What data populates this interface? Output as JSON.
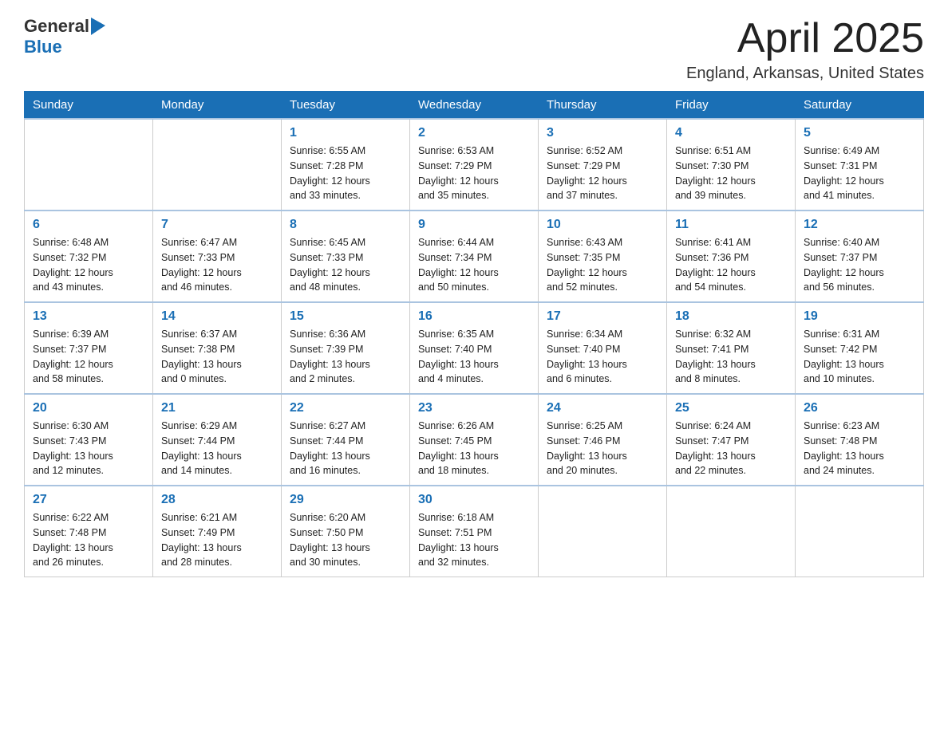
{
  "header": {
    "logo_general": "General",
    "logo_blue": "Blue",
    "title": "April 2025",
    "location": "England, Arkansas, United States"
  },
  "days_of_week": [
    "Sunday",
    "Monday",
    "Tuesday",
    "Wednesday",
    "Thursday",
    "Friday",
    "Saturday"
  ],
  "weeks": [
    [
      {
        "day": "",
        "info": ""
      },
      {
        "day": "",
        "info": ""
      },
      {
        "day": "1",
        "info": "Sunrise: 6:55 AM\nSunset: 7:28 PM\nDaylight: 12 hours\nand 33 minutes."
      },
      {
        "day": "2",
        "info": "Sunrise: 6:53 AM\nSunset: 7:29 PM\nDaylight: 12 hours\nand 35 minutes."
      },
      {
        "day": "3",
        "info": "Sunrise: 6:52 AM\nSunset: 7:29 PM\nDaylight: 12 hours\nand 37 minutes."
      },
      {
        "day": "4",
        "info": "Sunrise: 6:51 AM\nSunset: 7:30 PM\nDaylight: 12 hours\nand 39 minutes."
      },
      {
        "day": "5",
        "info": "Sunrise: 6:49 AM\nSunset: 7:31 PM\nDaylight: 12 hours\nand 41 minutes."
      }
    ],
    [
      {
        "day": "6",
        "info": "Sunrise: 6:48 AM\nSunset: 7:32 PM\nDaylight: 12 hours\nand 43 minutes."
      },
      {
        "day": "7",
        "info": "Sunrise: 6:47 AM\nSunset: 7:33 PM\nDaylight: 12 hours\nand 46 minutes."
      },
      {
        "day": "8",
        "info": "Sunrise: 6:45 AM\nSunset: 7:33 PM\nDaylight: 12 hours\nand 48 minutes."
      },
      {
        "day": "9",
        "info": "Sunrise: 6:44 AM\nSunset: 7:34 PM\nDaylight: 12 hours\nand 50 minutes."
      },
      {
        "day": "10",
        "info": "Sunrise: 6:43 AM\nSunset: 7:35 PM\nDaylight: 12 hours\nand 52 minutes."
      },
      {
        "day": "11",
        "info": "Sunrise: 6:41 AM\nSunset: 7:36 PM\nDaylight: 12 hours\nand 54 minutes."
      },
      {
        "day": "12",
        "info": "Sunrise: 6:40 AM\nSunset: 7:37 PM\nDaylight: 12 hours\nand 56 minutes."
      }
    ],
    [
      {
        "day": "13",
        "info": "Sunrise: 6:39 AM\nSunset: 7:37 PM\nDaylight: 12 hours\nand 58 minutes."
      },
      {
        "day": "14",
        "info": "Sunrise: 6:37 AM\nSunset: 7:38 PM\nDaylight: 13 hours\nand 0 minutes."
      },
      {
        "day": "15",
        "info": "Sunrise: 6:36 AM\nSunset: 7:39 PM\nDaylight: 13 hours\nand 2 minutes."
      },
      {
        "day": "16",
        "info": "Sunrise: 6:35 AM\nSunset: 7:40 PM\nDaylight: 13 hours\nand 4 minutes."
      },
      {
        "day": "17",
        "info": "Sunrise: 6:34 AM\nSunset: 7:40 PM\nDaylight: 13 hours\nand 6 minutes."
      },
      {
        "day": "18",
        "info": "Sunrise: 6:32 AM\nSunset: 7:41 PM\nDaylight: 13 hours\nand 8 minutes."
      },
      {
        "day": "19",
        "info": "Sunrise: 6:31 AM\nSunset: 7:42 PM\nDaylight: 13 hours\nand 10 minutes."
      }
    ],
    [
      {
        "day": "20",
        "info": "Sunrise: 6:30 AM\nSunset: 7:43 PM\nDaylight: 13 hours\nand 12 minutes."
      },
      {
        "day": "21",
        "info": "Sunrise: 6:29 AM\nSunset: 7:44 PM\nDaylight: 13 hours\nand 14 minutes."
      },
      {
        "day": "22",
        "info": "Sunrise: 6:27 AM\nSunset: 7:44 PM\nDaylight: 13 hours\nand 16 minutes."
      },
      {
        "day": "23",
        "info": "Sunrise: 6:26 AM\nSunset: 7:45 PM\nDaylight: 13 hours\nand 18 minutes."
      },
      {
        "day": "24",
        "info": "Sunrise: 6:25 AM\nSunset: 7:46 PM\nDaylight: 13 hours\nand 20 minutes."
      },
      {
        "day": "25",
        "info": "Sunrise: 6:24 AM\nSunset: 7:47 PM\nDaylight: 13 hours\nand 22 minutes."
      },
      {
        "day": "26",
        "info": "Sunrise: 6:23 AM\nSunset: 7:48 PM\nDaylight: 13 hours\nand 24 minutes."
      }
    ],
    [
      {
        "day": "27",
        "info": "Sunrise: 6:22 AM\nSunset: 7:48 PM\nDaylight: 13 hours\nand 26 minutes."
      },
      {
        "day": "28",
        "info": "Sunrise: 6:21 AM\nSunset: 7:49 PM\nDaylight: 13 hours\nand 28 minutes."
      },
      {
        "day": "29",
        "info": "Sunrise: 6:20 AM\nSunset: 7:50 PM\nDaylight: 13 hours\nand 30 minutes."
      },
      {
        "day": "30",
        "info": "Sunrise: 6:18 AM\nSunset: 7:51 PM\nDaylight: 13 hours\nand 32 minutes."
      },
      {
        "day": "",
        "info": ""
      },
      {
        "day": "",
        "info": ""
      },
      {
        "day": "",
        "info": ""
      }
    ]
  ]
}
